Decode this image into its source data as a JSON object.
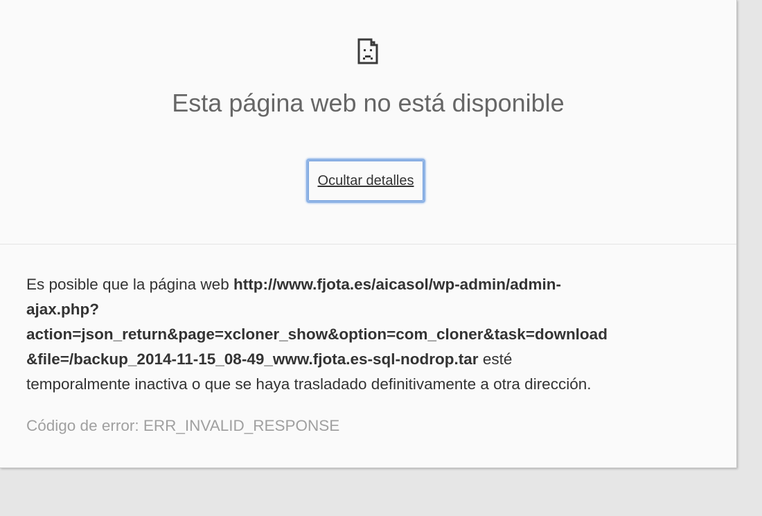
{
  "error_page": {
    "icon": "sad-page-icon",
    "title": "Esta página web no está disponible",
    "details_button_label": "Ocultar detalles",
    "details": {
      "prefix": "Es posible que la página web",
      "url_line1": "http://www.fjota.es/aicasol/wp-admin/admin-",
      "url_line2": "ajax.php?",
      "url_line3": "action=json_return&page=xcloner_show&option=com_cloner&task=download",
      "url_line4": "&file=/backup_2014-11-15_08-49_www.fjota.es-sql-nodrop.tar",
      "suffix_line4": "esté",
      "suffix_line5": "temporalmente inactiva o que se haya trasladado definitivamente a otra dirección."
    },
    "error_code": "Código de error: ERR_INVALID_RESPONSE"
  },
  "colors": {
    "background": "#e6e6e6",
    "card": "#fafafa",
    "title": "#666666",
    "text": "#333333",
    "error_code": "#a0a0a0",
    "focus_ring": "#8fb4e6"
  }
}
